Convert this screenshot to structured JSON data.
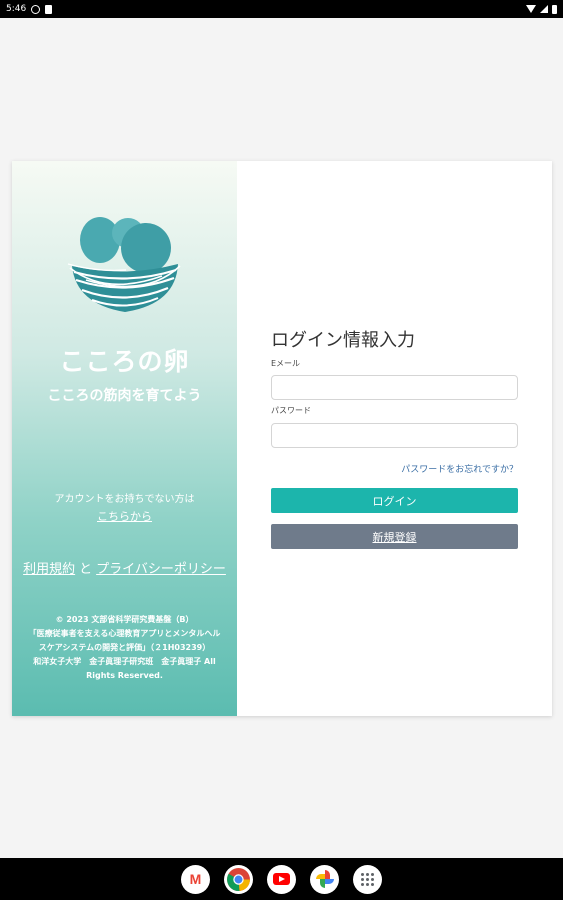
{
  "status_bar": {
    "time": "5:46",
    "icons": [
      "sync-icon",
      "sim-card-icon",
      "wifi-icon",
      "signal-icon",
      "battery-icon"
    ]
  },
  "brand": {
    "title": "こころの卵",
    "subtitle": "こころの筋肉を育てよう",
    "logo": "egg-nest-logo",
    "colors": {
      "teal": "#5bbcb0",
      "egg": "#4aa9b0",
      "nest": "#2f8f97"
    }
  },
  "signup_prompt": {
    "text": "アカウントをお持ちでない方は",
    "link": "こちらから"
  },
  "legal": {
    "terms": "利用規約",
    "and": "と",
    "privacy": "プライバシーポリシー"
  },
  "copyright": {
    "line1": "© 2023 文部省科学研究費基盤（B）",
    "line2": "「医療従事者を支える心理教育アプリとメンタルヘル",
    "line3": "スケアシステムの開発と評価」（２1H03239）",
    "line4": "和洋女子大学　金子眞理子研究班　金子眞理子 All",
    "line5": "Rights Reserved."
  },
  "form": {
    "title": "ログイン情報入力",
    "email_label": "Eメール",
    "email_value": "",
    "password_label": "パスワード",
    "password_value": "",
    "forgot": "パスワードをお忘れですか？",
    "login_button": "ログイン",
    "register_button": "新規登録",
    "colors": {
      "login": "#1cb5ac",
      "register": "#6f7b8b",
      "link": "#3a6ea5"
    }
  },
  "dock": {
    "apps": [
      "gmail-icon",
      "chrome-icon",
      "youtube-icon",
      "photos-icon",
      "app-drawer-icon"
    ]
  }
}
